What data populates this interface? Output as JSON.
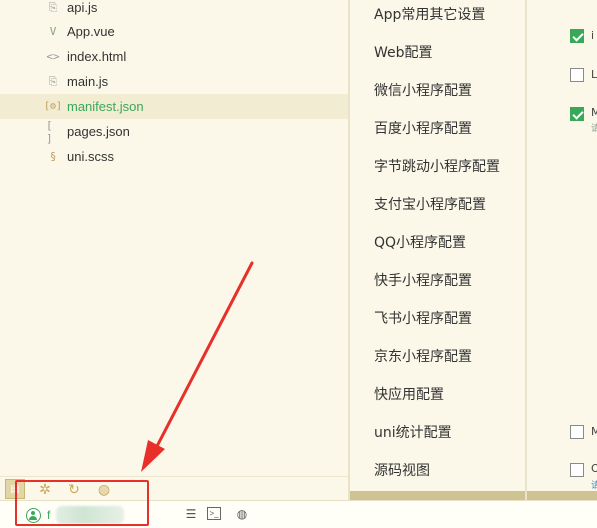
{
  "explorer": {
    "files": [
      {
        "name": "api.js",
        "icon": "js-file-icon",
        "glyph": "⎘"
      },
      {
        "name": "App.vue",
        "icon": "vue-file-icon",
        "glyph": "V"
      },
      {
        "name": "index.html",
        "icon": "html-file-icon",
        "glyph": "<>"
      },
      {
        "name": "main.js",
        "icon": "js-file-icon",
        "glyph": "⎘"
      },
      {
        "name": "manifest.json",
        "icon": "json-file-icon",
        "glyph": "[⚙]",
        "selected": true
      },
      {
        "name": "pages.json",
        "icon": "json-file-icon",
        "glyph": "[ ]"
      },
      {
        "name": "uni.scss",
        "icon": "scss-file-icon",
        "glyph": "ꟽ"
      }
    ]
  },
  "settings_nav": {
    "items": [
      "App常用其它设置",
      "Web配置",
      "微信小程序配置",
      "百度小程序配置",
      "字节跳动小程序配置",
      "支付宝小程序配置",
      "QQ小程序配置",
      "快手小程序配置",
      "飞书小程序配置",
      "京东小程序配置",
      "快应用配置",
      "uni统计配置",
      "源码视图"
    ]
  },
  "options_panel": {
    "options": [
      {
        "label": "i",
        "checked": true
      },
      {
        "label": "L",
        "checked": false
      },
      {
        "label": "M",
        "sub": "请",
        "checked": true
      },
      {
        "label": "M",
        "checked": false
      },
      {
        "label": "O",
        "sub": "请",
        "checked": false
      }
    ]
  },
  "panel_toolbar": {
    "icons": [
      "explorer-icon",
      "bug-icon",
      "history-icon",
      "preview-icon"
    ]
  },
  "status_bar": {
    "account_name": "f",
    "icons": [
      "list-icon",
      "terminal-icon",
      "globe-icon"
    ]
  },
  "annotation": {
    "color": "#e8302a"
  },
  "colors": {
    "accent": "#3aa859",
    "background": "#fbf8e9"
  }
}
